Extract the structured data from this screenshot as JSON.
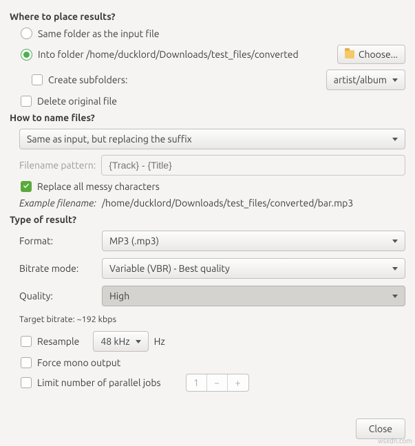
{
  "place": {
    "title": "Where to place results?",
    "same_folder": "Same folder as the input file",
    "into_folder_prefix": "Into folder ",
    "into_folder_path": "/home/ducklord/Downloads/test_files/converted",
    "choose": "Choose...",
    "create_subfolders": "Create subfolders:",
    "subfolder_pattern": "artist/album",
    "delete_original": "Delete original file"
  },
  "name": {
    "title": "How to name files?",
    "mode": "Same as input, but replacing the suffix",
    "pattern_label": "Filename pattern:",
    "pattern_placeholder": "{Track} - {Title}",
    "replace_messy": "Replace all messy characters",
    "example_label": "Example filename: ",
    "example_value": "/home/ducklord/Downloads/test_files/converted/bar.mp3"
  },
  "result": {
    "title": "Type of result?",
    "format_label": "Format:",
    "format_value": "MP3 (.mp3)",
    "bitrate_mode_label": "Bitrate mode:",
    "bitrate_mode_value": "Variable (VBR) - Best quality",
    "quality_label": "Quality:",
    "quality_value": "High",
    "target_bitrate": "Target bitrate: ~192 kbps",
    "resample": "Resample",
    "resample_value": "48 kHz",
    "resample_unit": "Hz",
    "force_mono": "Force mono output",
    "limit_jobs": "Limit number of parallel jobs",
    "limit_jobs_value": "1",
    "minus": "−",
    "plus": "+"
  },
  "footer": {
    "close": "Close"
  },
  "watermark": "wsxdn.com"
}
